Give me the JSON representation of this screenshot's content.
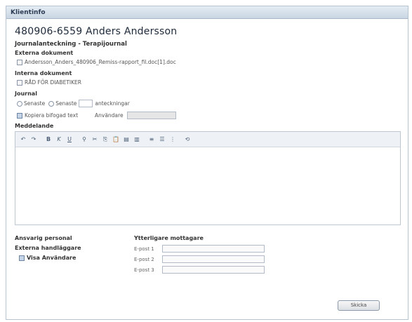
{
  "window": {
    "title": "Klientinfo"
  },
  "patient": {
    "header": "480906-6559 Anders Andersson"
  },
  "journal_entry": {
    "subtitle": "Journalanteckning - Terapijournal"
  },
  "external_docs": {
    "title": "Externa dokument",
    "file": "Andersson_Anders_480906_Remiss-rapport_fil.doc[1].doc"
  },
  "internal_docs": {
    "title": "Interna dokument",
    "item": "RÅD FÖR DIABETIKER"
  },
  "journal": {
    "title": "Journal",
    "radio1": "Senaste",
    "radio2": "Senaste",
    "suffix": "anteckningar",
    "copy_label": "Kopiera bifogad text",
    "user_label": "Användare"
  },
  "message": {
    "title": "Meddelande"
  },
  "bottom": {
    "responsible": "Ansvarig personal",
    "external": "Externa handläggare",
    "show_all": "Visa Användare",
    "more_recipients": "Ytterligare mottagare",
    "email_labels": [
      "E-post 1",
      "E-post 2",
      "E-post 3"
    ]
  },
  "send_button": "Skicka"
}
